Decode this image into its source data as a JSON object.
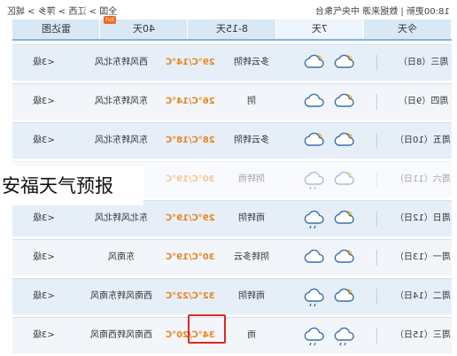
{
  "topbar": {
    "breadcrumb": "全国 > 江西 > 萍乡 > 城区",
    "update": "18:00更新 | 数据来源 中央气象台"
  },
  "tabs": [
    {
      "label": "今天"
    },
    {
      "label": "7天"
    },
    {
      "label": "8-15天"
    },
    {
      "label": "40天",
      "badge": "hot"
    },
    {
      "label": "雷达图"
    }
  ],
  "overlay_title": "安福天气预报",
  "rows": [
    {
      "day": "周三（8日）",
      "icon_day": "partly-cloudy-icon",
      "icon_night": "partly-cloudy-icon",
      "weather": "多云转阴",
      "temp": "29℃/14℃",
      "wind": "西风转东北风",
      "level": "<3级"
    },
    {
      "day": "周四（9日）",
      "icon_day": "cloudy-icon",
      "icon_night": "partly-cloudy-icon",
      "weather": "阴",
      "temp": "26℃/14℃",
      "wind": "东风转东北风",
      "level": "<3级"
    },
    {
      "day": "周五（10日）",
      "icon_day": "partly-cloudy-icon",
      "icon_night": "partly-cloudy-icon",
      "weather": "多云转阴",
      "temp": "28℃/18℃",
      "wind": "东风转东北风",
      "level": "<3级"
    },
    {
      "day": "周六（11日）",
      "icon_day": "rain-icon",
      "icon_night": "partly-cloudy-icon",
      "weather": "阴转雨",
      "temp": "30℃/19℃",
      "wind": "",
      "level": ""
    },
    {
      "day": "周日（12日）",
      "icon_day": "rain-icon",
      "icon_night": "partly-cloudy-icon",
      "weather": "雨转阴",
      "temp": "29℃/19℃",
      "wind": "东北风转北风",
      "level": "<3级"
    },
    {
      "day": "周一（13日）",
      "icon_day": "cloudy-icon",
      "icon_night": "partly-cloudy-icon",
      "weather": "阴转多云",
      "temp": "30℃/19℃",
      "wind": "东南风",
      "level": "<3级"
    },
    {
      "day": "周二（14日）",
      "icon_day": "rain-icon",
      "icon_night": "partly-cloudy-icon",
      "weather": "雨转阴",
      "temp": "32℃/22℃",
      "wind": "西南风转东南风",
      "level": "<3级"
    },
    {
      "day": "周三（15日）",
      "icon_day": "rain-icon",
      "icon_night": "rain-icon",
      "weather": "雨",
      "temp": "34℃/20℃",
      "wind": "西南风转西南风",
      "level": "<3级"
    }
  ],
  "colors": {
    "tab_bg": "#d9e8f5",
    "temp": "#e8851c",
    "highlight": "#e0281e"
  }
}
